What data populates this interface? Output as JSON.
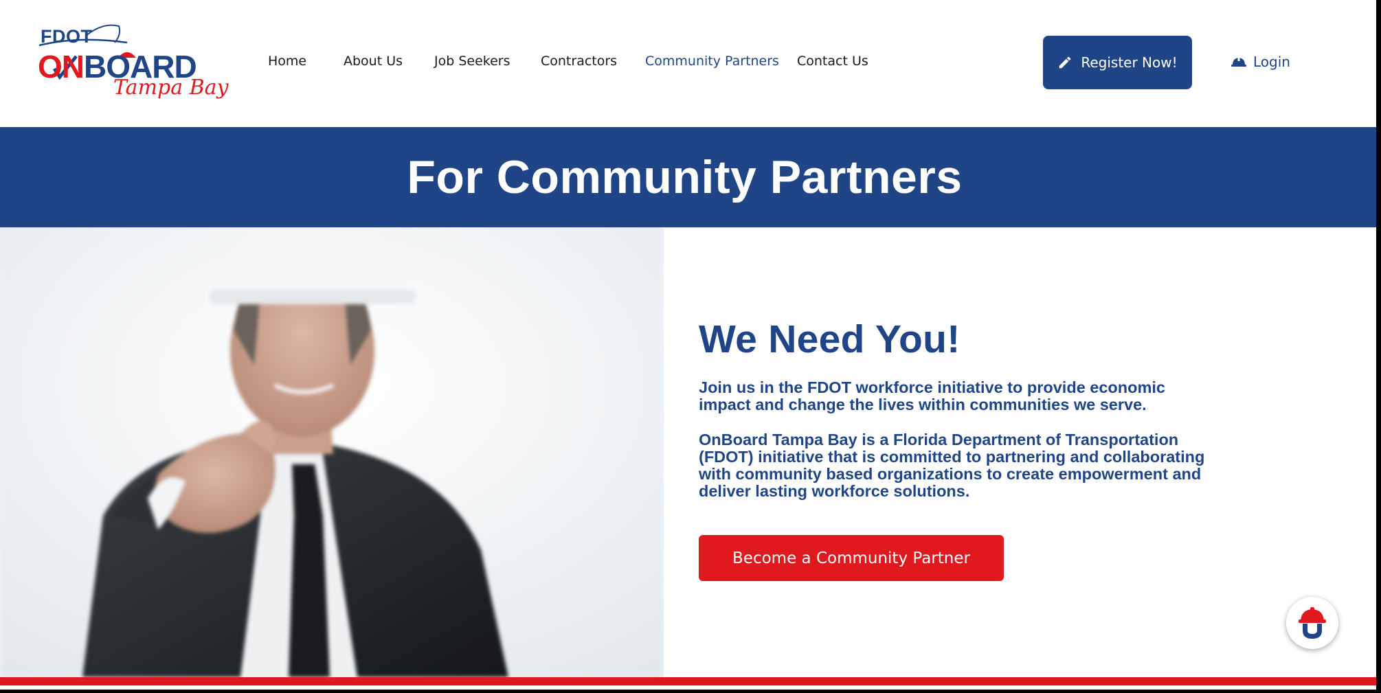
{
  "logo": {
    "fdot": "FDOT",
    "onboard_o": "O",
    "onboard_n": "N",
    "onboard_rest": "BOARD",
    "tampa_bay": "Tampa Bay"
  },
  "nav": {
    "items": [
      {
        "label": "Home"
      },
      {
        "label": "About Us"
      },
      {
        "label": "Job Seekers"
      },
      {
        "label": "Contractors"
      },
      {
        "label": "Community Partners",
        "active": true
      },
      {
        "label": "Contact Us"
      }
    ]
  },
  "header": {
    "register_label": "Register Now!",
    "login_label": "Login"
  },
  "banner": {
    "title": "For Community Partners"
  },
  "hero": {
    "heading": "We Need You!",
    "paragraph1": "Join us in the FDOT workforce initiative to provide economic impact and change the lives within communities we serve.",
    "paragraph2": "OnBoard Tampa Bay is a Florida Department of Transportation (FDOT) initiative that is committed to partnering and collaborating with community based organizations to create empowerment and deliver lasting workforce solutions.",
    "cta_label": "Become a Community Partner",
    "image_icon": "man-pointing-photo"
  },
  "icons": {
    "register": "pencil-icon",
    "login": "hardhat-icon",
    "chat": "hardhat-chat-icon"
  },
  "colors": {
    "brand_blue": "#1f4586",
    "brand_red": "#e0191f"
  }
}
